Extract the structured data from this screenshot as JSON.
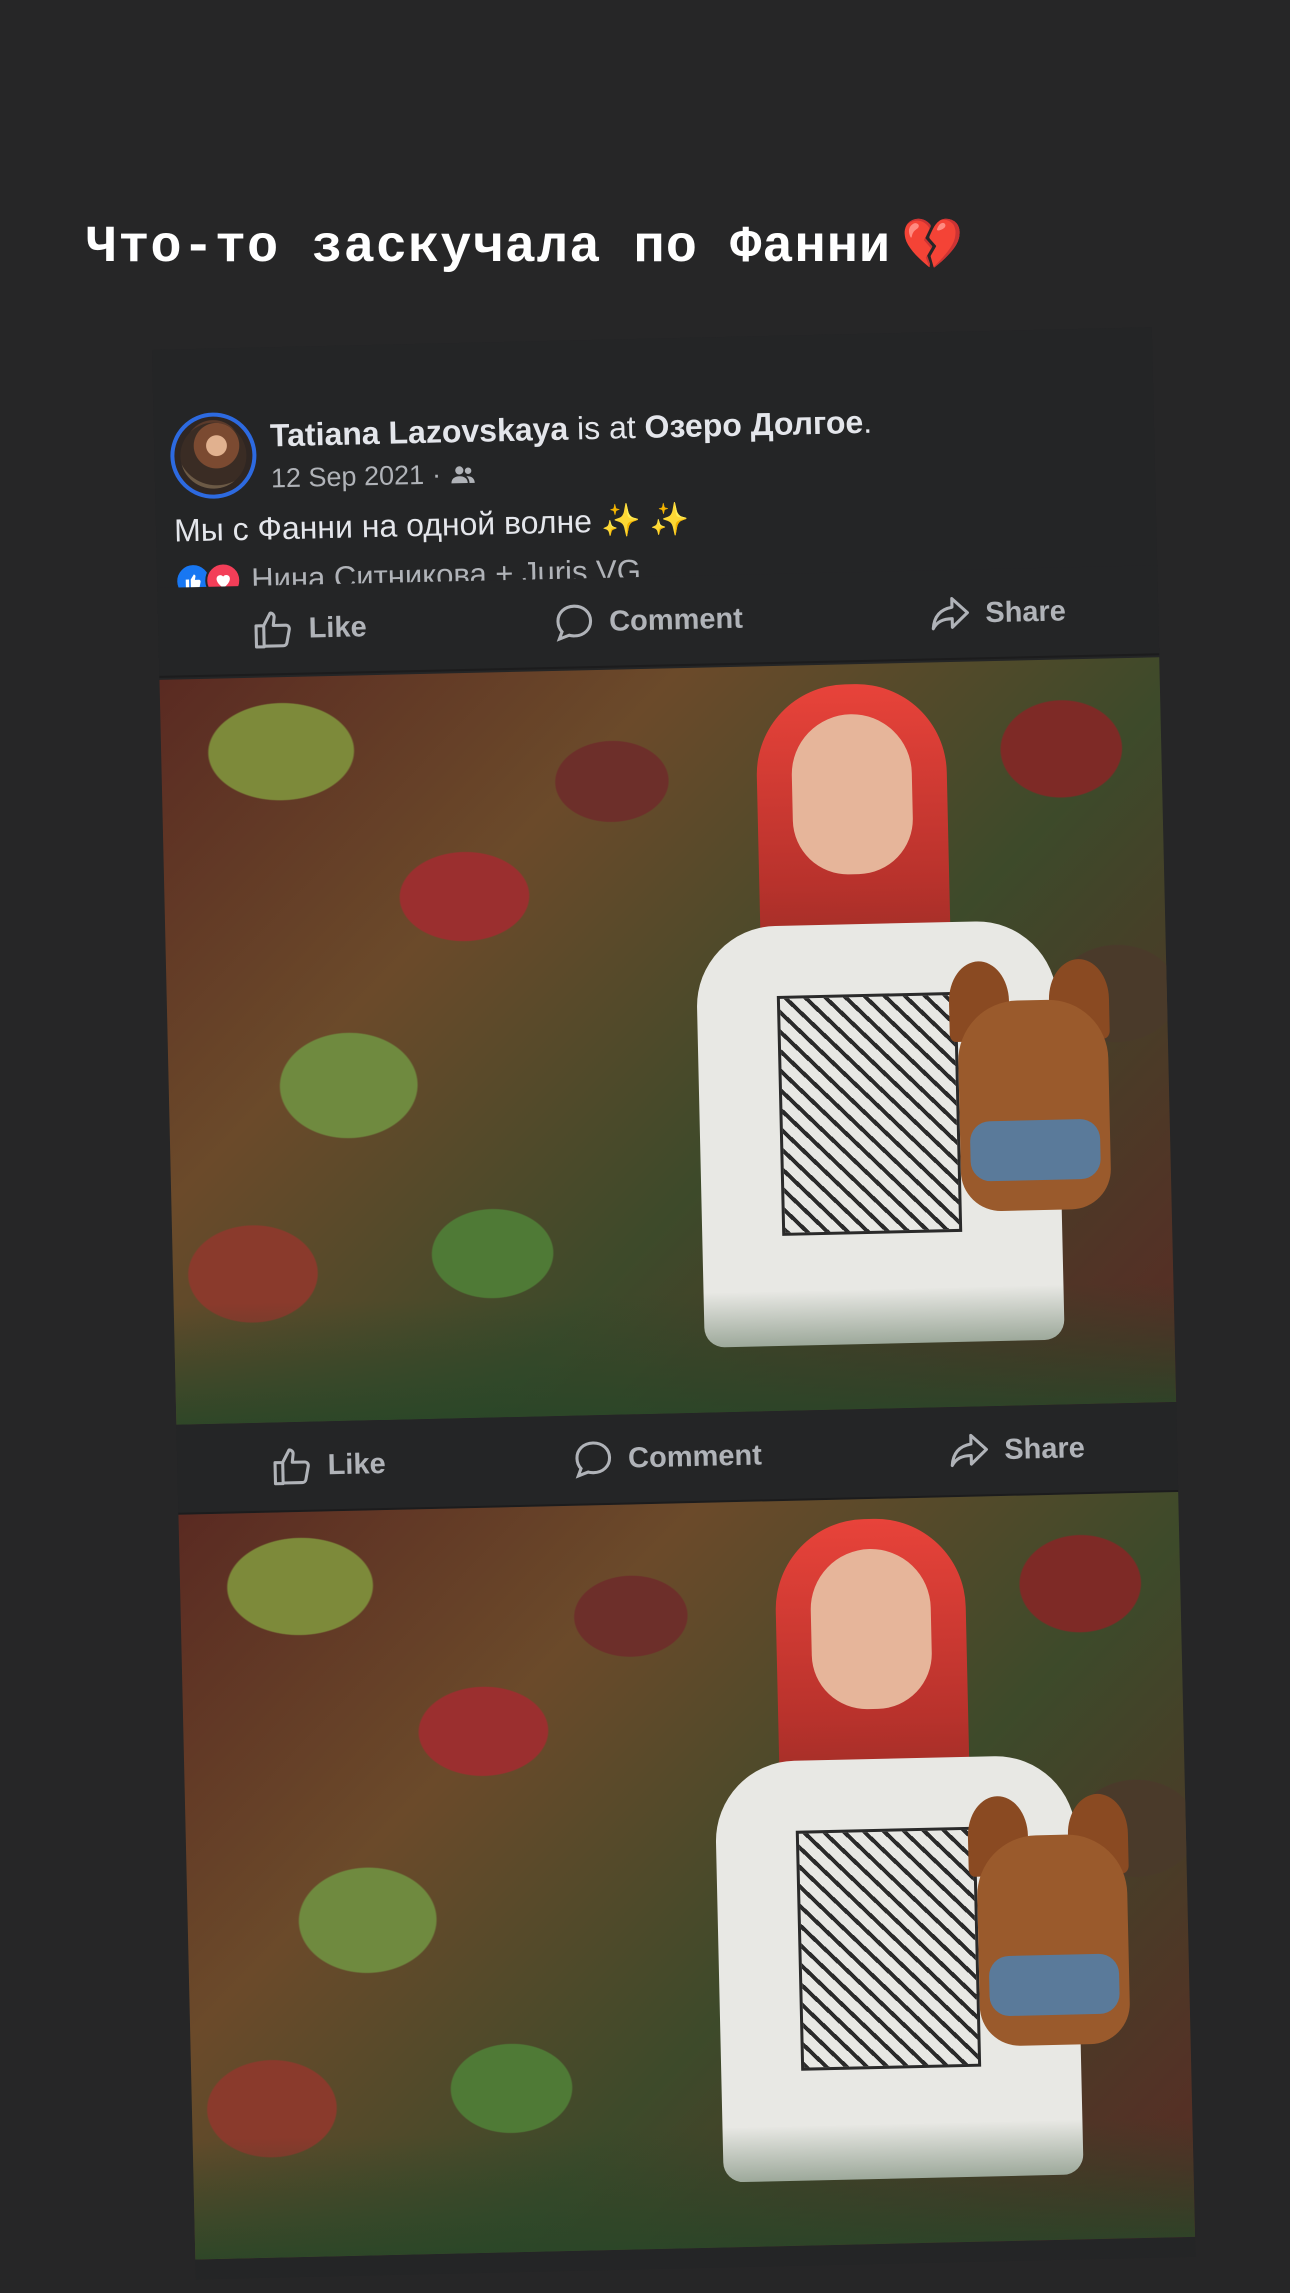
{
  "story": {
    "caption_text": "Что-то заскучала по Фанни",
    "caption_emoji": "💔"
  },
  "post": {
    "author": "Tatiana Lazovskaya",
    "at_text": " is at ",
    "location": "Озеро Долгое",
    "location_suffix": ".",
    "date": "12 Sep 2021",
    "date_separator": "·",
    "audience_icon": "friends-icon",
    "text": "Мы с Фанни на одной волне",
    "text_emoji": "✨ ✨",
    "reactions": {
      "icons": [
        "like-reaction-icon",
        "love-reaction-icon"
      ],
      "names": "Нина Ситникова + Juris VG"
    },
    "actions_top": {
      "like": "Like",
      "comment": "Comment",
      "share": "Share"
    },
    "actions_mid": {
      "like": "Like",
      "comment": "Comment",
      "share": "Share"
    }
  },
  "colors": {
    "background": "#262627",
    "card": "#242526",
    "like_blue": "#1877f2",
    "love_red": "#f33e58",
    "avatar_ring": "#2d6ae0"
  }
}
